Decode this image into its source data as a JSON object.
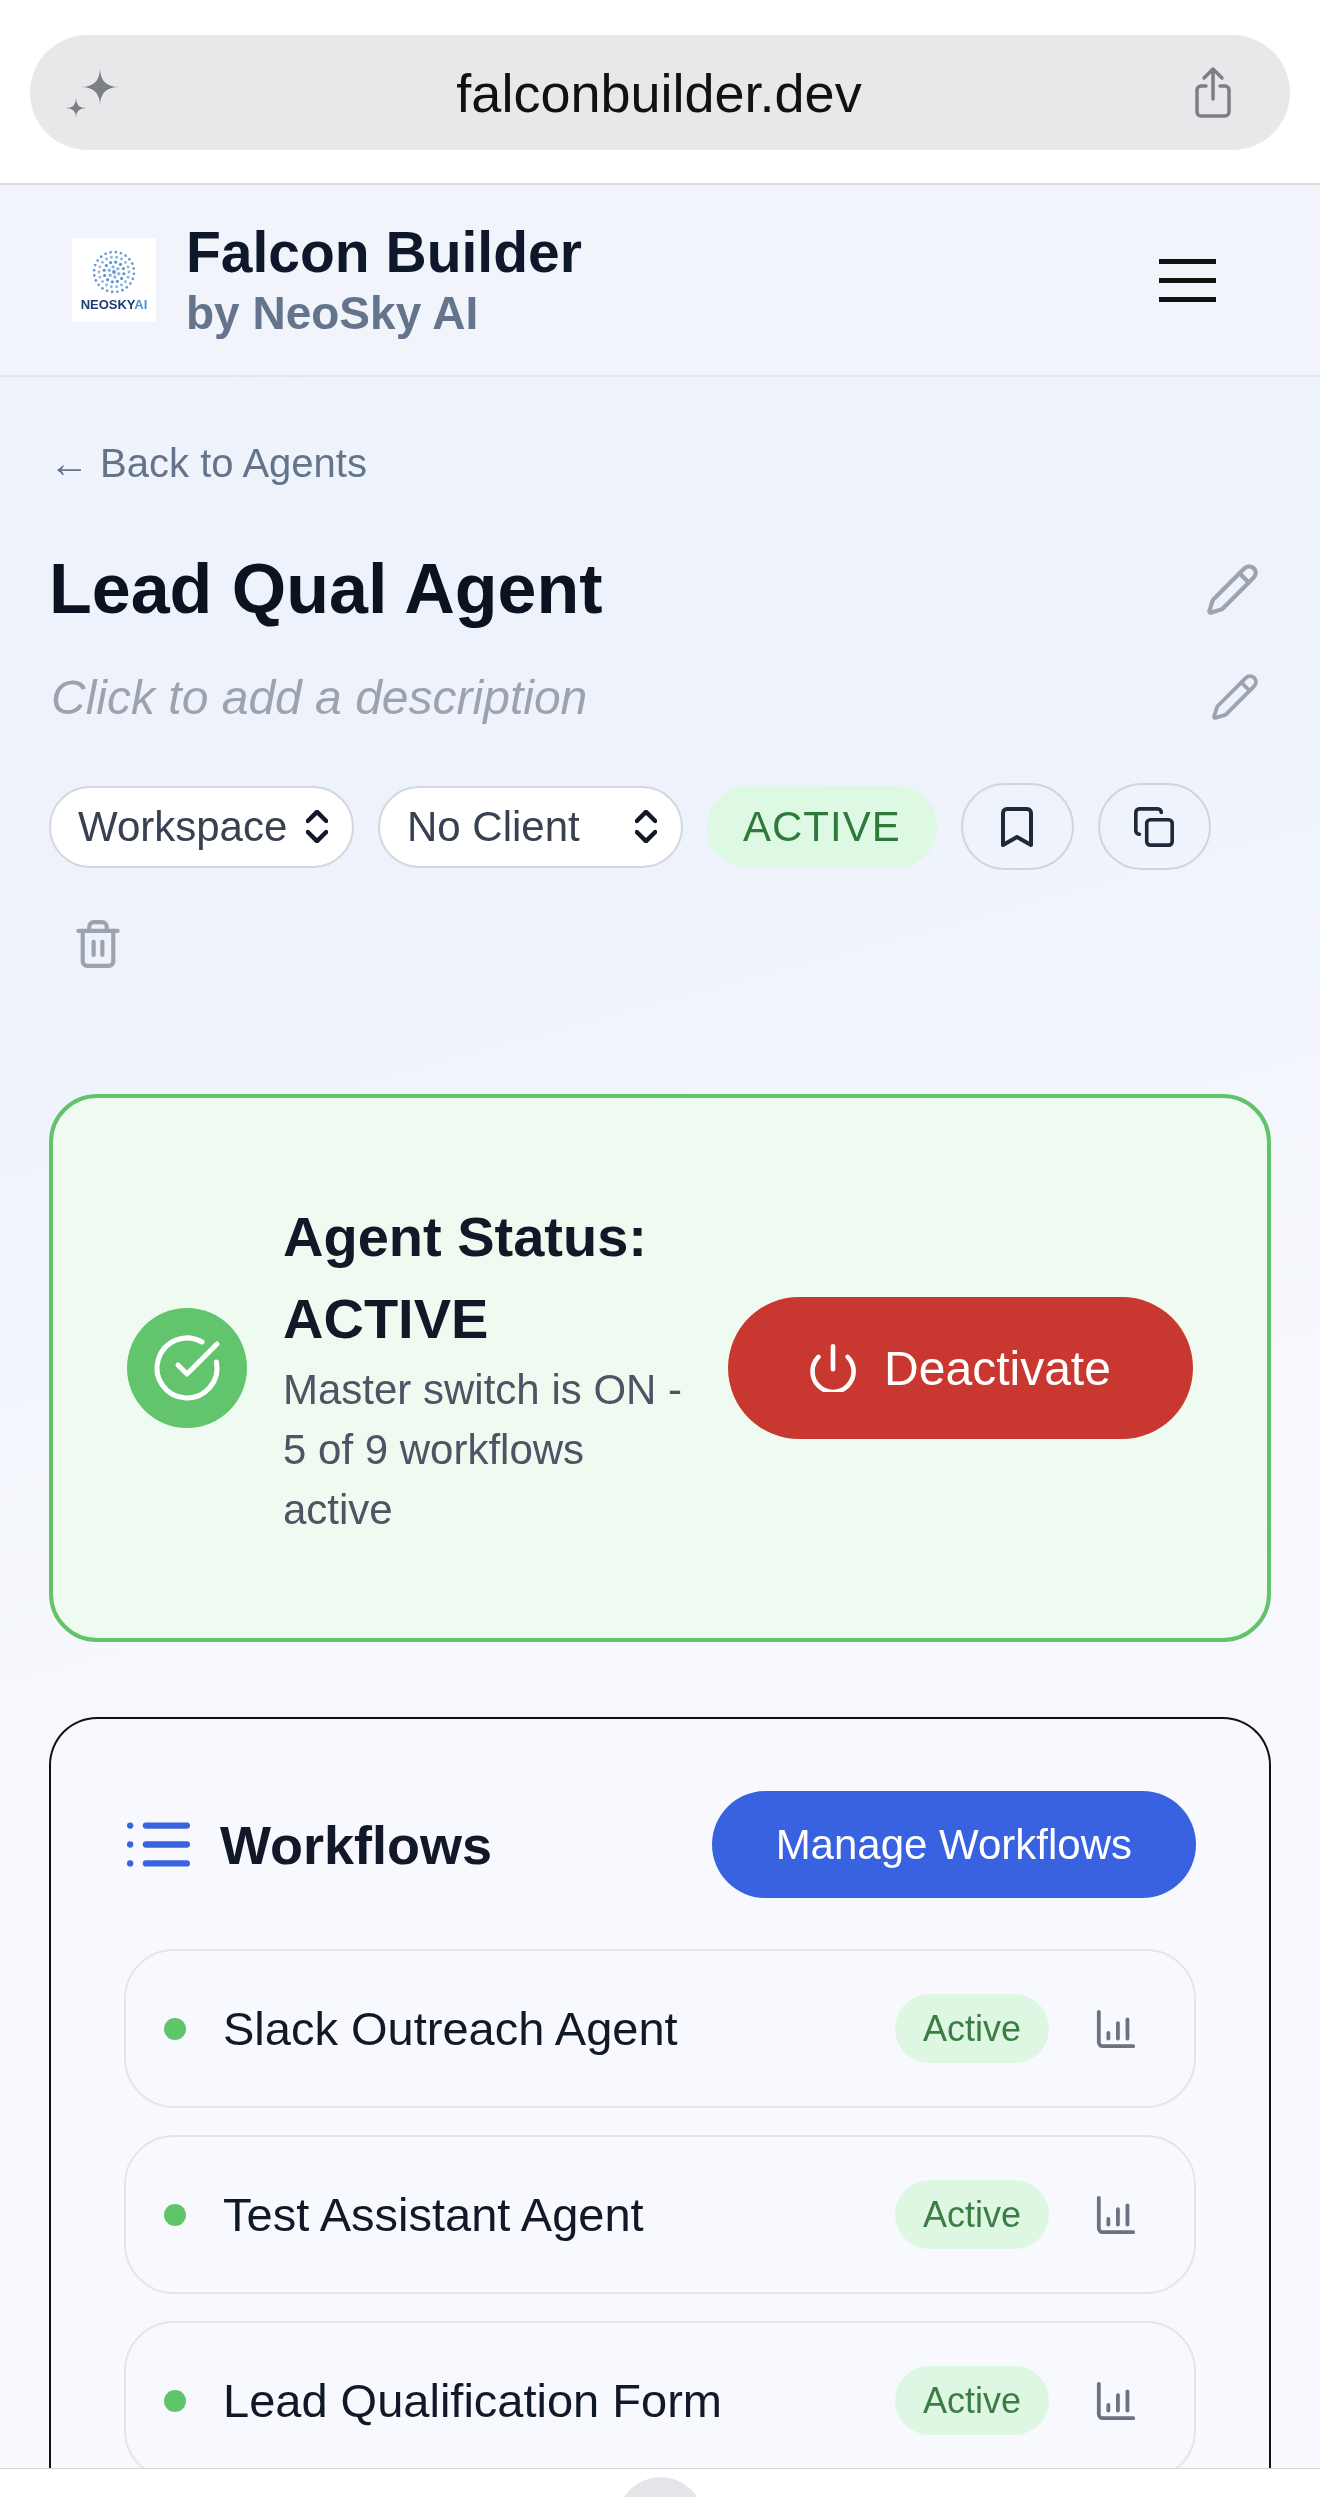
{
  "browser": {
    "url": "falconbuilder.dev"
  },
  "header": {
    "logo": {
      "wordmark": "NEOSKY",
      "wordmark_accent": "AI"
    },
    "title": "Falcon Builder",
    "subtitle": "by NeoSky AI"
  },
  "back_link": "← Back to Agents",
  "agent": {
    "name": "Lead Qual Agent",
    "description": {
      "placeholder": "Click to add a description"
    }
  },
  "controls": [
    {
      "kind": "select",
      "value": "Workspace"
    },
    {
      "kind": "select",
      "value": "No Client"
    },
    {
      "kind": "status",
      "label": "ACTIVE"
    },
    {
      "kind": "save"
    },
    {
      "kind": "duplicate"
    },
    {
      "kind": "delete"
    }
  ],
  "status_card": {
    "title": "Agent Status: ACTIVE",
    "message": "Master switch is ON - 5 of 9 workflows active",
    "button": "Deactivate"
  },
  "workflows": {
    "title": "Workflows",
    "button": "Manage Workflows",
    "items": [
      {
        "name": "Slack Outreach Agent",
        "status": "Active",
        "color": "#5fc46a"
      },
      {
        "name": "Test Assistant Agent",
        "status": "Active",
        "color": "#5fc46a"
      },
      {
        "name": "Lead Qualification Form",
        "status": "Active",
        "color": "#5fc46a"
      }
    ]
  }
}
